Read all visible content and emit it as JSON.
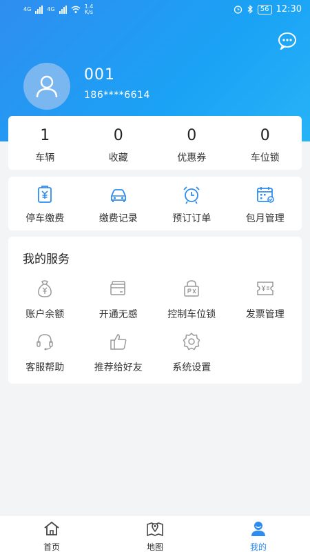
{
  "status_bar": {
    "network_1": "4G",
    "network_2": "4G",
    "speed_value": "1.4",
    "speed_unit": "K/s",
    "battery": "56",
    "time": "12:30"
  },
  "profile": {
    "username": "001",
    "phone": "186****6614"
  },
  "stats": [
    {
      "value": "1",
      "label": "车辆"
    },
    {
      "value": "0",
      "label": "收藏"
    },
    {
      "value": "0",
      "label": "优惠券"
    },
    {
      "value": "0",
      "label": "车位锁"
    }
  ],
  "quick_actions": [
    {
      "label": "停车缴费",
      "icon": "parking-payment-icon"
    },
    {
      "label": "缴费记录",
      "icon": "car-icon"
    },
    {
      "label": "预订订单",
      "icon": "alarm-clock-icon"
    },
    {
      "label": "包月管理",
      "icon": "calendar-icon"
    }
  ],
  "services": {
    "title": "我的服务",
    "items": [
      {
        "label": "账户余额",
        "icon": "money-bag-icon"
      },
      {
        "label": "开通无感",
        "icon": "card-icon"
      },
      {
        "label": "控制车位锁",
        "icon": "parking-lock-icon"
      },
      {
        "label": "发票管理",
        "icon": "invoice-icon"
      },
      {
        "label": "客服帮助",
        "icon": "headset-icon"
      },
      {
        "label": "推荐给好友",
        "icon": "thumbs-up-icon"
      },
      {
        "label": "系统设置",
        "icon": "gear-icon"
      }
    ]
  },
  "bottom_nav": [
    {
      "label": "首页",
      "icon": "home-icon"
    },
    {
      "label": "地图",
      "icon": "map-icon"
    },
    {
      "label": "我的",
      "icon": "user-icon",
      "active": true
    }
  ],
  "colors": {
    "primary": "#2e8cf0",
    "quick_icon": "#2e8cf0",
    "service_icon": "#999999"
  }
}
